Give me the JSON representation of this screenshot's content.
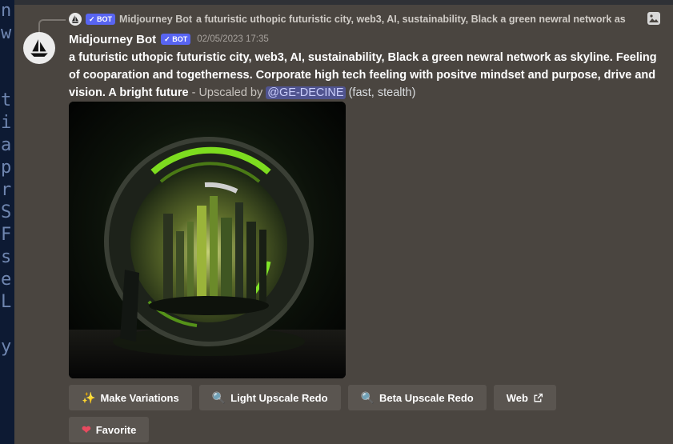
{
  "left_strip_glyphs": [
    "n",
    "w",
    "",
    "",
    "t",
    "i",
    "a",
    "p",
    "r",
    "S",
    "F",
    "s",
    "e",
    "L",
    "",
    "y"
  ],
  "reply": {
    "bot_tag": "✓ BOT",
    "author": "Midjourney Bot",
    "snippet": "a futuristic uthopic futuristic city, web3, AI, sustainability, Black a green newral network as"
  },
  "message": {
    "author": "Midjourney Bot",
    "bot_tag": "✓ BOT",
    "timestamp": "02/05/2023 17:35",
    "prompt": "a futuristic uthopic futuristic city, web3, AI, sustainability, Black a green newral network as skyline. Feeling of cooparation and togetherness. Corporate high tech feeling with positve mindset and purpose, drive and vision. A bright future",
    "upscaled_by": " - Upscaled by ",
    "mention": "@GE-DECINE",
    "tail": " (fast, stealth)"
  },
  "buttons": {
    "make_variations": "Make Variations",
    "light_upscale_redo": "Light Upscale Redo",
    "beta_upscale_redo": "Beta Upscale Redo",
    "web": "Web",
    "favorite": "Favorite"
  },
  "colors": {
    "background": "#4a4540",
    "button": "#5a5550",
    "bot_tag": "#5865f2",
    "mention_bg": "#5865f2",
    "art_green": "#7ddc1f"
  },
  "icons": [
    "sailboat-icon",
    "image-icon",
    "sparkles-icon",
    "magnifier-icon",
    "external-link-icon",
    "heart-icon"
  ]
}
